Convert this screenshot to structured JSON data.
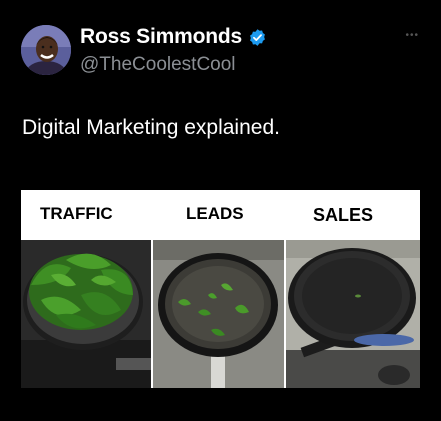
{
  "author": {
    "name": "Ross Simmonds",
    "handle": "@TheCoolestCool",
    "verified": true
  },
  "menu_icon": "more-dots-icon",
  "tweet_text": "Digital Marketing explained.",
  "meme": {
    "labels": [
      "TRAFFIC",
      "LEADS",
      "SALES"
    ]
  },
  "colors": {
    "background": "#000000",
    "verified_badge": "#1d9bf0",
    "handle_text": "#8b8f94"
  }
}
